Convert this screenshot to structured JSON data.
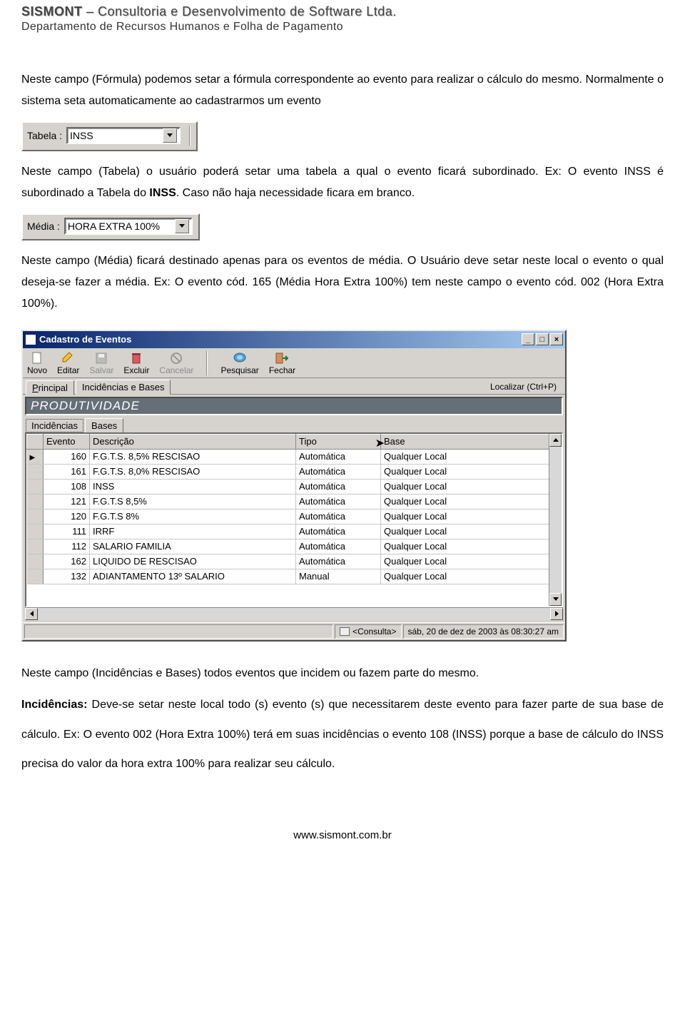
{
  "header": {
    "company_bold": "SISMONT",
    "company_rest": " – Consultoria e Desenvolvimento de Software Ltda.",
    "department": "Departamento de Recursos Humanos e Folha de Pagamento"
  },
  "para1": "Neste campo (Fórmula) podemos setar a fórmula correspondente ao evento para realizar o cálculo do mesmo. Normalmente o sistema seta automaticamente ao cadastrarmos um evento",
  "tabela_field": {
    "label": "Tabela :",
    "value": "INSS"
  },
  "para2a": "Neste campo (Tabela) o usuário poderá setar uma tabela a qual o evento ficará subordinado. Ex: O evento INSS é subordinado a Tabela do ",
  "para2b_bold": "INSS",
  "para2c": ". Caso não haja necessidade ficara em branco.",
  "media_field": {
    "label": "Média :",
    "value": "HORA EXTRA 100%"
  },
  "para3": "Neste campo (Média) ficará destinado apenas para os eventos de média. O Usuário deve setar neste local o evento o qual deseja-se fazer a média. Ex: O evento cód. 165 (Média Hora Extra 100%) tem neste campo o evento cód. 002 (Hora Extra 100%).",
  "window": {
    "title": "Cadastro de Eventos",
    "toolbar": {
      "novo": "Novo",
      "editar": "Editar",
      "salvar": "Salvar",
      "excluir": "Excluir",
      "cancelar": "Cancelar",
      "pesquisar": "Pesquisar",
      "fechar": "Fechar"
    },
    "tabs": {
      "principal": "Principal",
      "incidencias": "Incidências e Bases",
      "localizar": "Localizar (Ctrl+P)"
    },
    "big_field": "PRODUTIVIDADE",
    "subtabs": {
      "incidencias": "Incidências",
      "bases": "Bases"
    },
    "columns": {
      "evento": "Evento",
      "descricao": "Descrição",
      "tipo": "Tipo",
      "base": "Base"
    },
    "rows": [
      {
        "evento": "160",
        "descricao": "F.G.T.S. 8,5% RESCISAO",
        "tipo": "Automática",
        "base": "Qualquer Local"
      },
      {
        "evento": "161",
        "descricao": "F.G.T.S. 8,0% RESCISAO",
        "tipo": "Automática",
        "base": "Qualquer Local"
      },
      {
        "evento": "108",
        "descricao": "INSS",
        "tipo": "Automática",
        "base": "Qualquer Local"
      },
      {
        "evento": "121",
        "descricao": "F.G.T.S 8,5%",
        "tipo": "Automática",
        "base": "Qualquer Local"
      },
      {
        "evento": "120",
        "descricao": "F.G.T.S 8%",
        "tipo": "Automática",
        "base": "Qualquer Local"
      },
      {
        "evento": "111",
        "descricao": "IRRF",
        "tipo": "Automática",
        "base": "Qualquer Local"
      },
      {
        "evento": "112",
        "descricao": "SALARIO FAMILIA",
        "tipo": "Automática",
        "base": "Qualquer Local"
      },
      {
        "evento": "162",
        "descricao": "LIQUIDO DE RESCISAO",
        "tipo": "Automática",
        "base": "Qualquer Local"
      },
      {
        "evento": "132",
        "descricao": "ADIANTAMENTO 13º SALARIO",
        "tipo": "Manual",
        "base": "Qualquer Local"
      }
    ],
    "status": {
      "mode": "<Consulta>",
      "datetime": "sáb, 20 de dez de 2003 às 08:30:27 am"
    }
  },
  "para4": "Neste campo (Incidências e Bases) todos eventos que incidem ou fazem parte do mesmo.",
  "para5a_bold": "Incidências:",
  "para5b": " Deve-se setar neste local todo (s) evento (s) que necessitarem deste evento para fazer parte de sua base de cálculo. Ex: O evento 002 (Hora Extra 100%) terá em suas incidências o evento 108 (INSS) porque a base de cálculo do INSS precisa do valor da hora extra 100% para realizar seu cálculo.",
  "footer": "www.sismont.com.br"
}
